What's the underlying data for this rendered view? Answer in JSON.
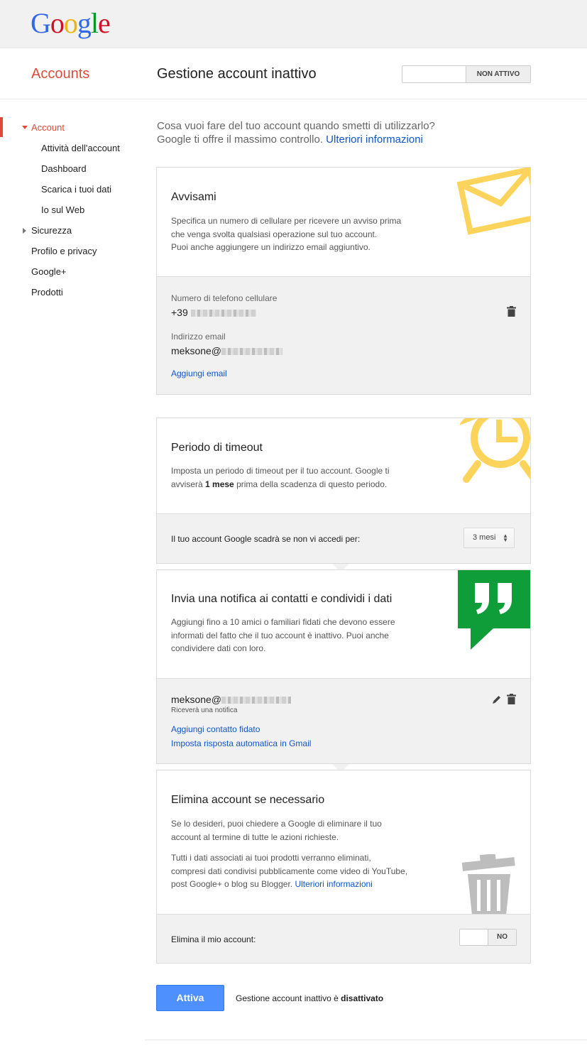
{
  "app": {
    "logo_letters": [
      "G",
      "o",
      "o",
      "g",
      "l",
      "e"
    ],
    "logo_colors": [
      "#3369e8",
      "#d50f25",
      "#eeb211",
      "#3369e8",
      "#009925",
      "#d50f25"
    ]
  },
  "header": {
    "accounts_label": "Accounts",
    "page_title": "Gestione account inattivo",
    "status_toggle": "NON ATTIVO"
  },
  "sidebar": {
    "items": [
      {
        "label": "Account"
      },
      {
        "label": "Attività dell'account"
      },
      {
        "label": "Dashboard"
      },
      {
        "label": "Scarica i tuoi dati"
      },
      {
        "label": "Io sul Web"
      },
      {
        "label": "Sicurezza"
      },
      {
        "label": "Profilo e privacy"
      },
      {
        "label": "Google+"
      },
      {
        "label": "Prodotti"
      }
    ]
  },
  "intro": {
    "line1": "Cosa vuoi fare del tuo account quando smetti di utilizzarlo?",
    "line2": "Google ti offre il massimo controllo.",
    "link": "Ulteriori informazioni"
  },
  "notify": {
    "title": "Avvisami",
    "desc1": "Specifica un numero di cellulare per ricevere un avviso prima",
    "desc2": "che venga svolta qualsiasi operazione sul tuo account.",
    "desc3": "Puoi anche aggiungere un indirizzo email aggiuntivo.",
    "phone_label": "Numero di telefono cellulare",
    "phone_value": "+39",
    "email_label": "Indirizzo email",
    "email_value": "meksone@",
    "add_email": "Aggiungi email",
    "icon": "envelope-icon"
  },
  "timeout": {
    "title": "Periodo di timeout",
    "desc1": "Imposta un periodo di timeout per il tuo account. Google ti",
    "desc2a": "avviserà",
    "desc2b": "1 mese",
    "desc2c": "prima della scadenza di questo periodo.",
    "expire_label": "Il tuo account Google scadrà se non vi accedi per:",
    "select_value": "3 mesi",
    "icon": "alarm-clock-icon"
  },
  "contacts": {
    "title": "Invia una notifica ai contatti e condividi i dati",
    "desc1": "Aggiungi fino a 10 amici o familiari fidati che devono essere",
    "desc2": "informati del fatto che il tuo account è inattivo. Puoi anche",
    "desc3": "condividere dati con loro.",
    "contact_email": "meksone@",
    "contact_note": "Riceverà una notifica",
    "add_contact": "Aggiungi contatto fidato",
    "auto_reply": "Imposta risposta automatica in Gmail",
    "icon": "quote-bubble-icon",
    "icon_color": "#0f9d3a"
  },
  "delete": {
    "title": "Elimina account se necessario",
    "desc1": "Se lo desideri, puoi chiedere a Google di eliminare il tuo",
    "desc2": "account al termine di tutte le azioni richieste.",
    "desc3": "Tutti i dati associati ai tuoi prodotti verranno eliminati,",
    "desc4": "compresi dati condivisi pubblicamente come video di YouTube,",
    "desc5": "post Google+ o blog su Blogger.",
    "more_link": "Ulteriori informazioni",
    "delete_label": "Elimina il mio account:",
    "toggle": "NO",
    "icon": "trash-bin-icon"
  },
  "footer": {
    "activate_button": "Attiva",
    "status_prefix": "Gestione account inattivo è",
    "status_value": "disattivato"
  },
  "colors": {
    "accent_red": "#dd4b39",
    "link_blue": "#1155cc",
    "button_blue": "#4d90fe",
    "icon_yellow": "#fdd45b",
    "icon_green": "#0f9d3a",
    "icon_gray": "#bdbdbd"
  }
}
